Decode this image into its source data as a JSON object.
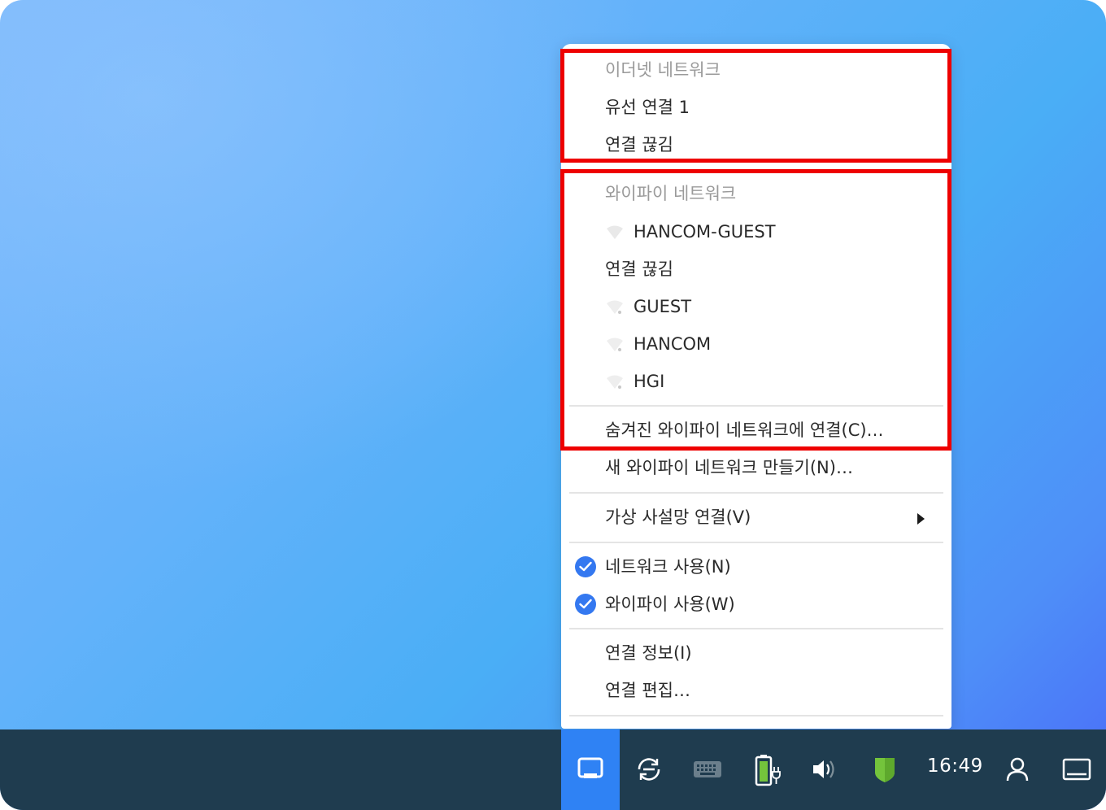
{
  "menu": {
    "ethernet": {
      "header": "이더넷 네트워크",
      "items": [
        "유선 연결 1",
        "연결 끊김"
      ]
    },
    "wifi": {
      "header": "와이파이 네트워크",
      "networks": [
        "HANCOM-GUEST",
        "GUEST",
        "HANCOM",
        "HGI"
      ],
      "status": "연결 끊김",
      "hidden_network": "숨겨진 와이파이 네트워크에 연결(C)…"
    },
    "new_wifi": "새 와이파이 네트워크 만들기(N)…",
    "vpn": "가상 사설망 연결(V)",
    "enable_networking": "네트워크 사용(N)",
    "enable_wifi": "와이파이 사용(W)",
    "connection_info": "연결 정보(I)",
    "edit_connections": "연결 편집…"
  },
  "taskbar": {
    "icons": [
      "network-icon",
      "sync-icon",
      "keyboard-icon",
      "battery-icon",
      "volume-icon",
      "shield-icon",
      "user-icon",
      "desktop-icon"
    ],
    "clock": "16:49",
    "active_color": "#2f82f4",
    "background_color": "#1f3c4f"
  },
  "colors": {
    "accent": "#3478f0",
    "highlight_box": "#ee0000",
    "shield": "#74c43c"
  }
}
